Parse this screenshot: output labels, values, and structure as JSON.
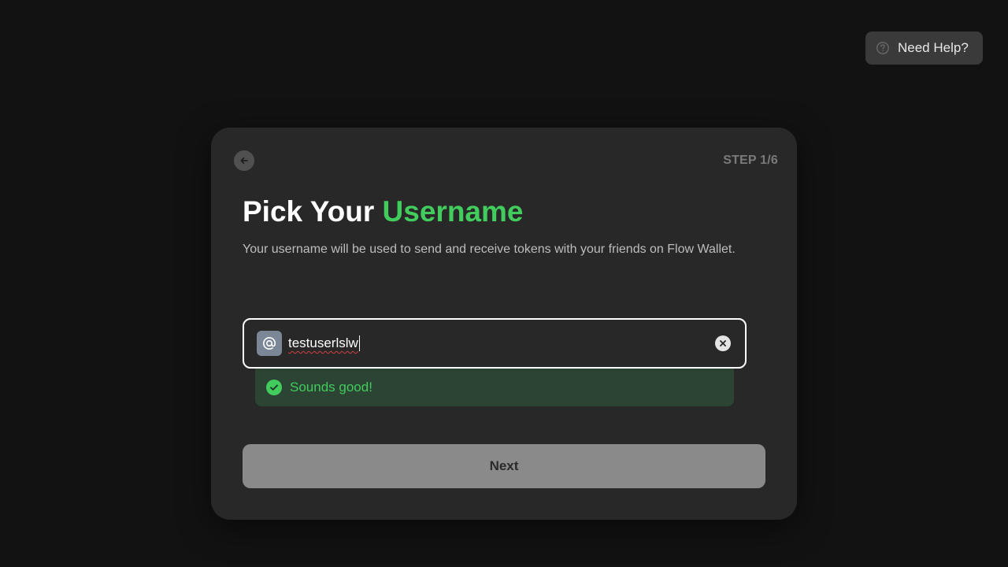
{
  "help": {
    "label": "Need Help?",
    "icon": "question-circle-icon"
  },
  "card": {
    "step": "STEP 1/6",
    "title_prefix": "Pick Your",
    "title_accent": "Username",
    "subtitle": "Your username will be used to send and receive tokens with your friends on Flow Wallet.",
    "back_icon": "arrow-left-icon"
  },
  "username": {
    "value": "testuserlslw",
    "prefix_icon": "at-sign-icon",
    "clear_icon": "close-icon"
  },
  "status": {
    "text": "Sounds good!",
    "icon": "check-circle-icon"
  },
  "next": {
    "label": "Next"
  },
  "colors": {
    "accent": "#41cc5d",
    "background": "#121212",
    "card": "#282828",
    "status_bg": "#2b4433",
    "button_disabled": "#8a8a8a"
  }
}
